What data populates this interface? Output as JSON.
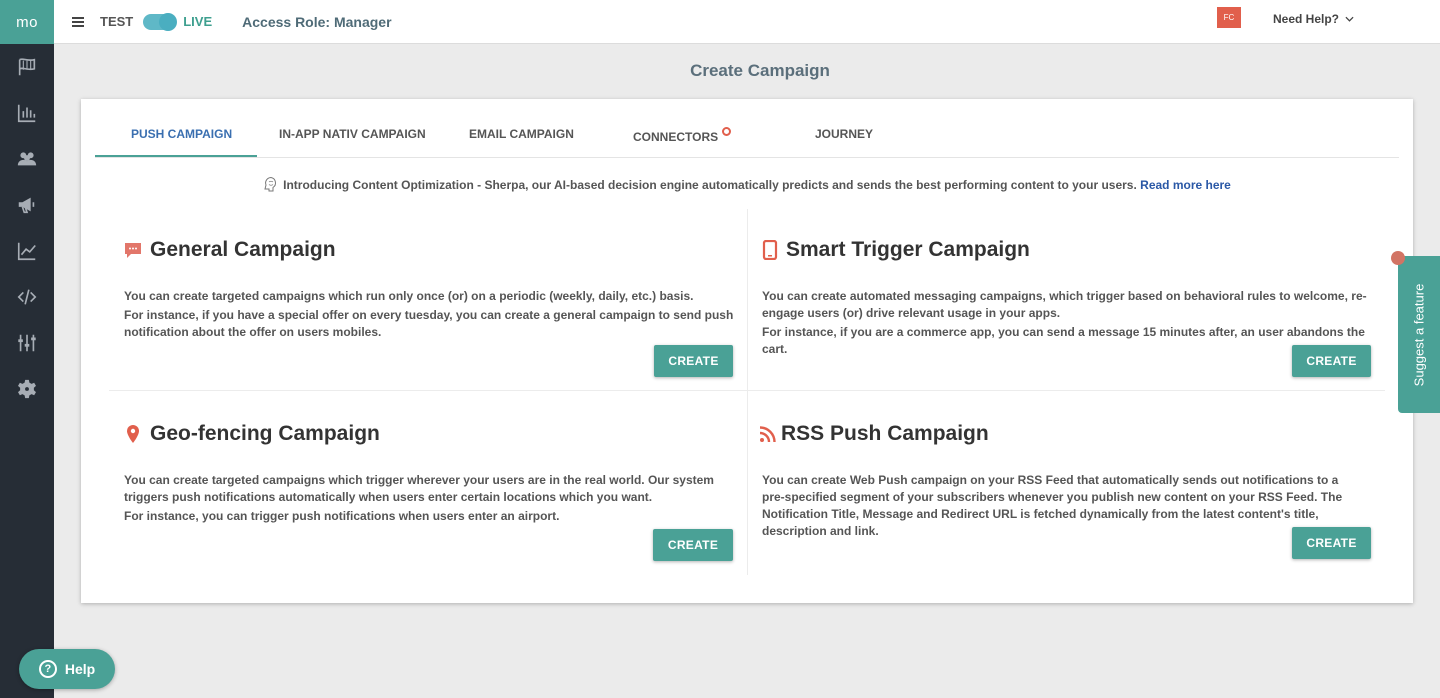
{
  "sidebar": {
    "logo": "mo",
    "icons": [
      "flag-icon",
      "bar-chart-icon",
      "users-icon",
      "megaphone-icon",
      "trend-line-icon",
      "code-icon",
      "sliders-icon",
      "settings-icon"
    ]
  },
  "topbar": {
    "env_test": "TEST",
    "env_live": "LIVE",
    "role": "Access Role: Manager",
    "avatar": "FC",
    "need_help": "Need Help?"
  },
  "page_title": "Create Campaign",
  "tabs": [
    "PUSH CAMPAIGN",
    "IN-APP NATIV CAMPAIGN",
    "EMAIL CAMPAIGN",
    "CONNECTORS",
    "JOURNEY"
  ],
  "active_tab": "PUSH CAMPAIGN",
  "intro": {
    "text": "Introducing Content Optimization - Sherpa, our AI-based decision engine automatically predicts and sends the best performing content to your users.",
    "link": "Read more here"
  },
  "campaigns": {
    "general": {
      "title": "General Campaign",
      "line1": "You can create targeted campaigns which run only once (or) on a periodic (weekly, daily, etc.) basis.",
      "line2": "For instance, if you have a special offer on every tuesday, you can create a general campaign to send push notification about the offer on users mobiles.",
      "button": "CREATE"
    },
    "smart": {
      "title": "Smart Trigger Campaign",
      "line1": "You can create automated messaging campaigns, which trigger based on behavioral rules to welcome, re-engage users (or) drive relevant usage in your apps.",
      "line2": "For instance, if you are a commerce app, you can send a message 15 minutes after, an user abandons the cart.",
      "button": "CREATE"
    },
    "geo": {
      "title": "Geo-fencing Campaign",
      "line1": "You can create targeted campaigns which trigger wherever your users are in the real world. Our system triggers push notifications automatically when users enter certain locations which you want.",
      "line2": "For instance, you can trigger push notifications when users enter an airport.",
      "button": "CREATE"
    },
    "rss": {
      "title": "RSS Push Campaign",
      "line1": "You can create Web Push campaign on your RSS Feed that automatically sends out notifications to a pre-specified segment of your subscribers whenever you publish new content on your RSS Feed. The Notification Title, Message and Redirect URL is fetched dynamically from the latest content's title, description and link.",
      "button": "CREATE"
    }
  },
  "suggest_feature": "Suggest a feature",
  "help": "Help",
  "colors": {
    "accent": "#4aa196",
    "sidebar": "#262d36",
    "active_tab": "#3a6fb0",
    "icon_red": "#e15f4c"
  }
}
